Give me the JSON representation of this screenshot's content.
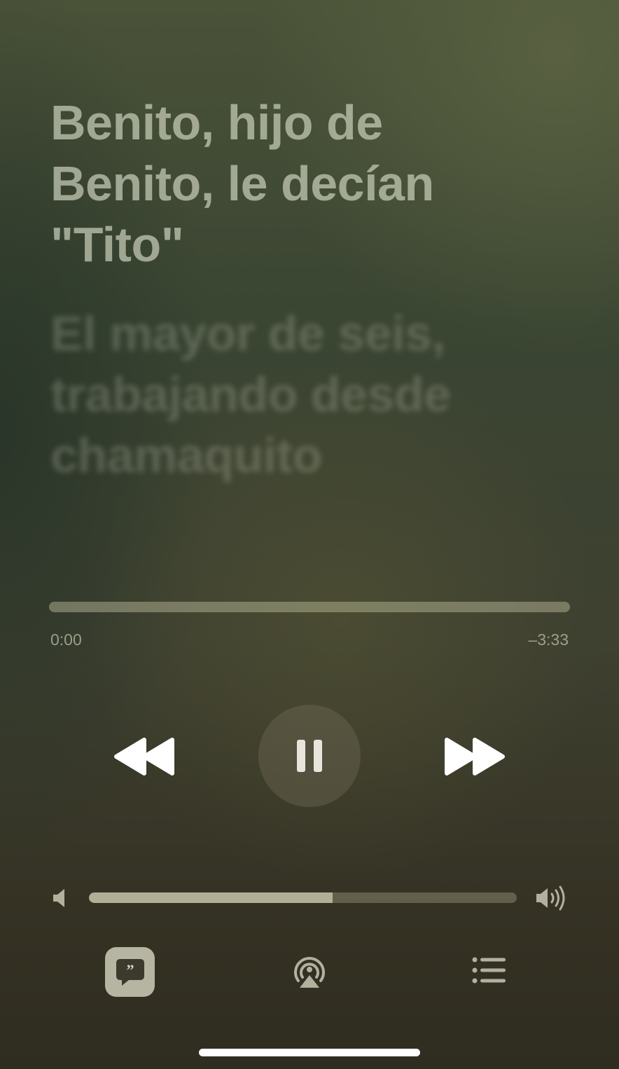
{
  "lyrics": {
    "current": [
      "Benito, hijo de",
      "Benito, le decían",
      "\"Tito\""
    ],
    "next": [
      "El mayor de seis,",
      "trabajando desde",
      "chamaquito"
    ]
  },
  "playback": {
    "elapsed": "0:00",
    "remaining": "–3:33",
    "progress_fraction": 0.0,
    "state": "playing"
  },
  "volume": {
    "level_fraction": 0.57
  },
  "controls": {
    "rewind_icon": "rewind-icon",
    "pause_icon": "pause-icon",
    "forward_icon": "fast-forward-icon"
  },
  "bottom_bar": {
    "lyrics_icon": "lyrics-quote-icon",
    "airplay_icon": "airplay-icon",
    "queue_icon": "queue-list-icon"
  },
  "colors": {
    "accent_text": "#c8cdb9",
    "icon": "#ffffff"
  }
}
